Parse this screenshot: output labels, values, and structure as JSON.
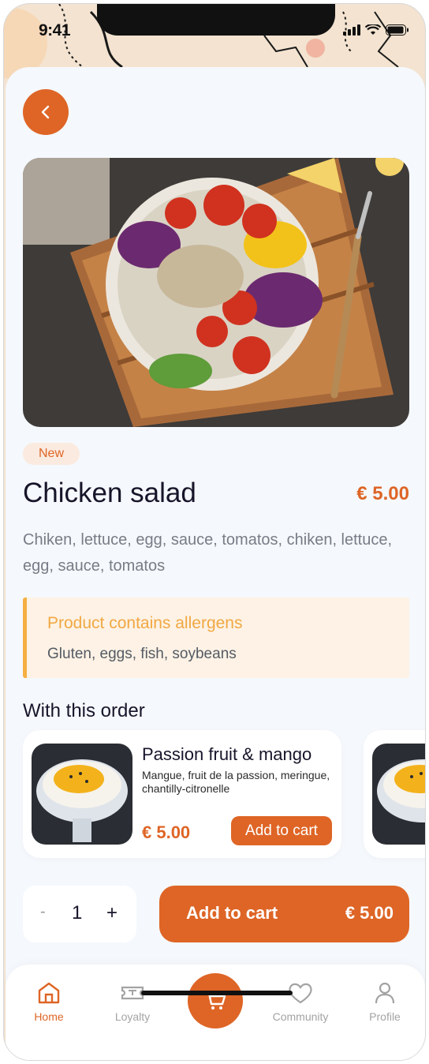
{
  "status_bar": {
    "time": "9:41"
  },
  "product": {
    "badge": "New",
    "name": "Chicken salad",
    "price": "€ 5.00",
    "description": "Chiken, lettuce, egg, sauce, tomatos, chiken, lettuce, egg, sauce, tomatos"
  },
  "allergens": {
    "title": "Product contains allergens",
    "list": "Gluten, eggs, fish, soybeans"
  },
  "with_order": {
    "title": "With this order",
    "items": [
      {
        "name": "Passion fruit & mango",
        "description": "Mangue, fruit de la passion, meringue, chantilly-citronelle",
        "price": "€ 5.00",
        "button_label": "Add to cart"
      }
    ]
  },
  "quantity": {
    "minus": "-",
    "value": "1",
    "plus": "+"
  },
  "cart_button": {
    "label": "Add to cart",
    "price": "€ 5.00"
  },
  "tabs": [
    {
      "label": "Home",
      "icon": "home-icon",
      "active": true
    },
    {
      "label": "Loyalty",
      "icon": "ticket-icon",
      "active": false
    },
    {
      "label": "",
      "icon": "cart-icon",
      "active": false
    },
    {
      "label": "Community",
      "icon": "heart-icon",
      "active": false
    },
    {
      "label": "Profile",
      "icon": "user-icon",
      "active": false
    }
  ],
  "colors": {
    "accent": "#de6526",
    "allergen_accent": "#f1a843",
    "background": "#f5f8fc"
  }
}
